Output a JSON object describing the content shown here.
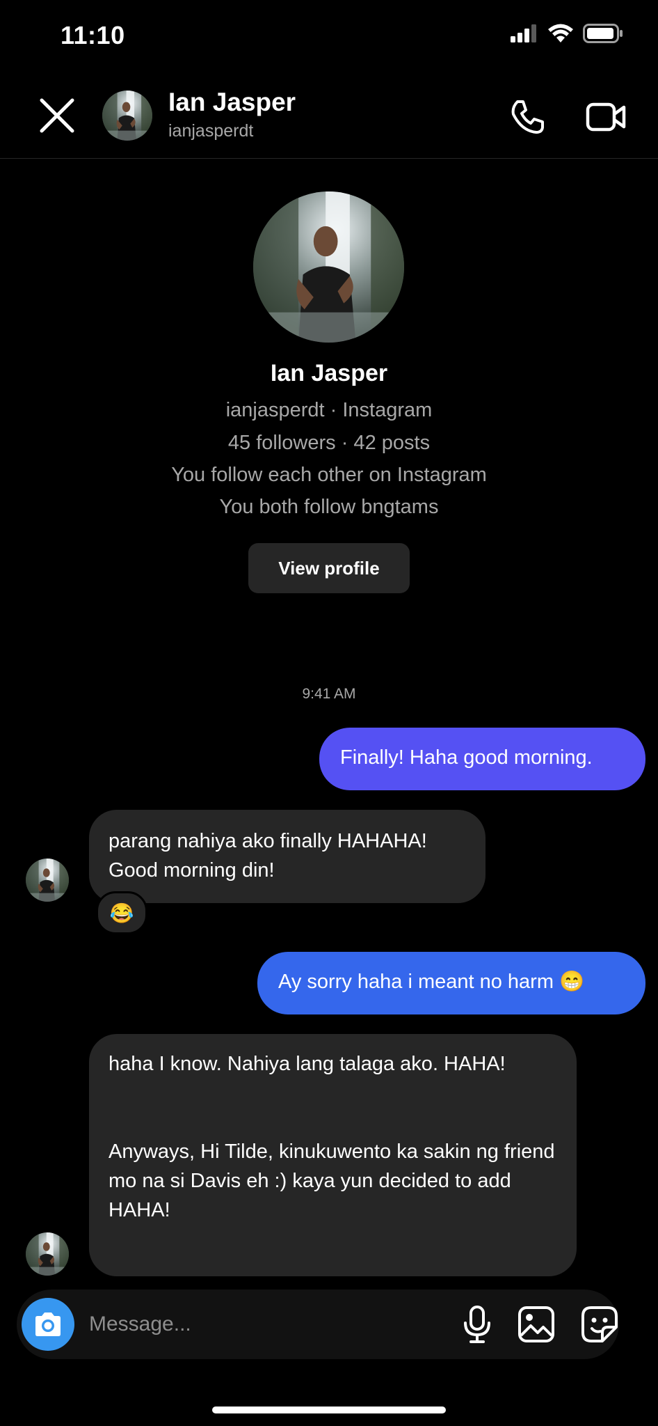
{
  "status_bar": {
    "time": "11:10"
  },
  "header": {
    "name": "Ian Jasper",
    "username": "ianjasperdt"
  },
  "profile": {
    "name": "Ian Jasper",
    "line1": "ianjasperdt · Instagram",
    "line2": "45 followers · 42 posts",
    "line3": "You follow each other on Instagram",
    "line4": "You both follow bngtams",
    "view_profile_label": "View profile"
  },
  "chat": {
    "timestamp": "9:41 AM",
    "messages": [
      {
        "from": "me",
        "text": "Finally! Haha good morning."
      },
      {
        "from": "them",
        "text": "parang nahiya ako finally HAHAHA! Good morning din!",
        "reaction": "😂"
      },
      {
        "from": "me",
        "text": "Ay sorry haha i meant no harm 😁"
      },
      {
        "from": "them",
        "text": "haha I know. Nahiya lang talaga ako. HAHA!\n\n\nAnyways, Hi Tilde, kinukuwento ka sakin ng friend mo na si Davis eh :) kaya yun decided to add HAHA!"
      }
    ]
  },
  "composer": {
    "placeholder": "Message..."
  },
  "colors": {
    "background": "#000000",
    "outgoing_bubble_1": "#5551f3",
    "outgoing_bubble_2": "#3567ec",
    "incoming_bubble": "#262626",
    "camera_button": "#3797f0",
    "secondary_text": "#a8a8a8"
  },
  "icons": [
    "signal-icon",
    "wifi-icon",
    "battery-icon",
    "close-icon",
    "phone-icon",
    "video-icon",
    "camera-icon",
    "microphone-icon",
    "gallery-icon",
    "sticker-icon"
  ]
}
